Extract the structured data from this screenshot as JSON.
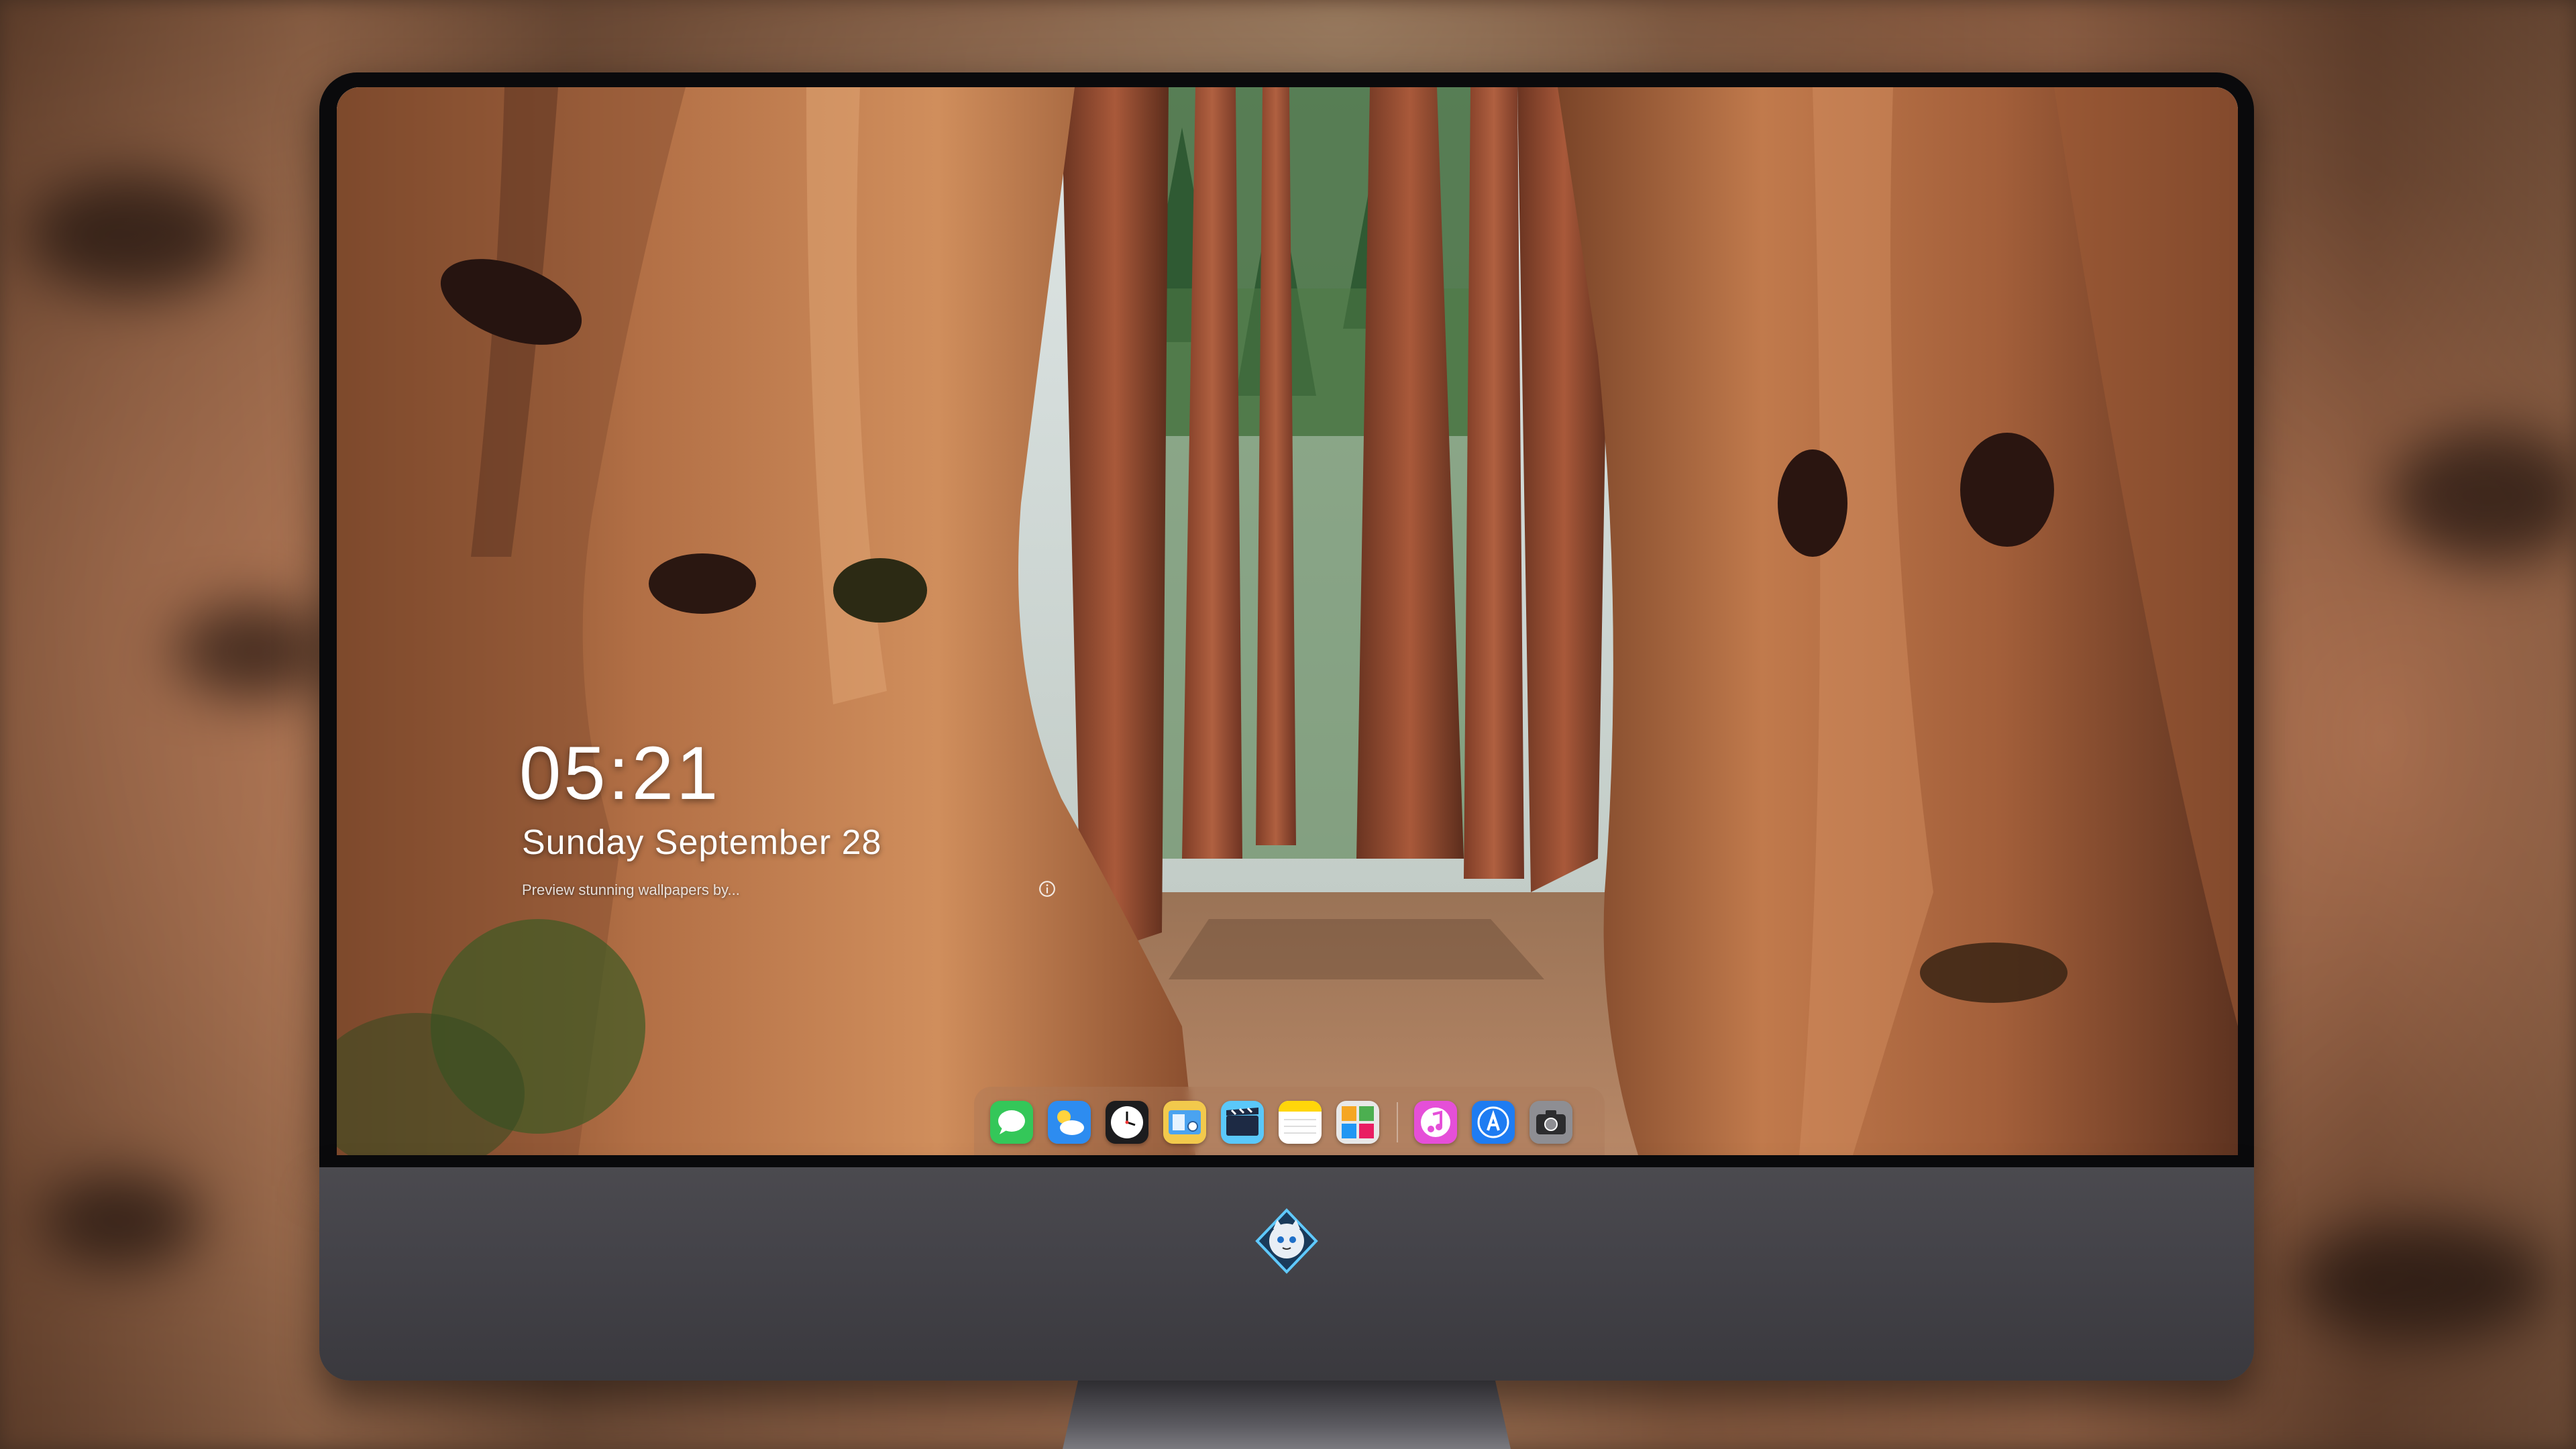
{
  "lock_screen": {
    "time": "05:21",
    "date": "Sunday September  28",
    "caption": "Preview stunning wallpapers by..."
  },
  "dock": {
    "apps": [
      {
        "name": "messages-app-icon",
        "color": "#34c759"
      },
      {
        "name": "weather-app-icon",
        "color": "#2d8cf0"
      },
      {
        "name": "clock-app-icon",
        "color": "#1c1c1e"
      },
      {
        "name": "finder-app-icon",
        "color": "#f2c94c"
      },
      {
        "name": "video-app-icon",
        "color": "#5ac8fa"
      },
      {
        "name": "notes-app-icon",
        "color": "#ffd60a"
      },
      {
        "name": "photos-app-icon",
        "color": "#e8e8e8"
      }
    ],
    "pinned_apps": [
      {
        "name": "music-app-icon",
        "color": "#e54fd8"
      },
      {
        "name": "app-store-icon",
        "color": "#1e7cf2"
      },
      {
        "name": "camera-app-icon",
        "color": "#8e8e93"
      }
    ]
  },
  "monitor": {
    "bezel_color": "#0a0a0c",
    "chin_color": "#444349",
    "brand_logo": "cat-mascot-logo"
  }
}
